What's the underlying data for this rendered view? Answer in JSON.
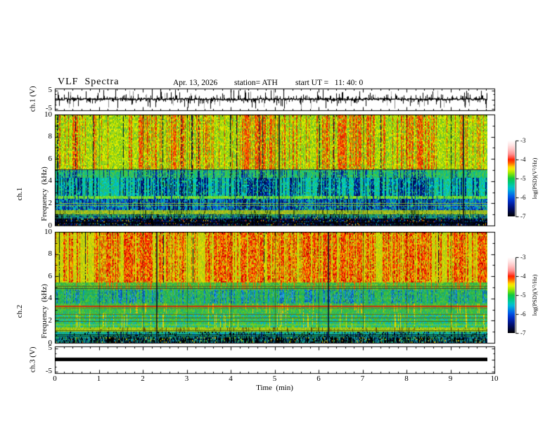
{
  "header": {
    "title": "VLF  Spectra",
    "date": "Apr. 13, 2026",
    "station": "station= ATH",
    "start_ut": "start UT =   11: 40: 0"
  },
  "axes": {
    "x_label": "Time  (min)",
    "x_ticks": [
      "0",
      "1",
      "2",
      "3",
      "4",
      "5",
      "6",
      "7",
      "8",
      "9",
      "10"
    ]
  },
  "panels": {
    "ch1_wave": {
      "ylabel": "ch.1 (V)",
      "y_ticks": [
        "5",
        "-5"
      ]
    },
    "ch1_spec": {
      "ylabel_line1": "ch.1",
      "ylabel_line2": "Frequency  (kHz)",
      "y_ticks": [
        "10",
        "8",
        "6",
        "4",
        "2",
        "0"
      ]
    },
    "ch2_spec": {
      "ylabel_line1": "ch.2",
      "ylabel_line2": "Frequency  (kHz)",
      "y_ticks": [
        "10",
        "8",
        "6",
        "4",
        "2",
        "0"
      ]
    },
    "ch3_wave": {
      "ylabel": "ch.3 (V)",
      "y_ticks": [
        "5",
        "-5"
      ]
    }
  },
  "colorbar": {
    "label": "log(PSD)(V²/Hz)",
    "ticks": [
      "-3",
      "-4",
      "-5",
      "-6",
      "-7"
    ],
    "gradient": [
      [
        "0",
        "#ffffff"
      ],
      [
        "6",
        "#ffe4e4"
      ],
      [
        "12",
        "#ffc0c0"
      ],
      [
        "18",
        "#ff9090"
      ],
      [
        "23",
        "#ff4838"
      ],
      [
        "25",
        "#ff2000"
      ],
      [
        "29",
        "#ff5800"
      ],
      [
        "32",
        "#ff9800"
      ],
      [
        "35",
        "#ffd800"
      ],
      [
        "38",
        "#e8f000"
      ],
      [
        "42",
        "#a8e800"
      ],
      [
        "47",
        "#48d820"
      ],
      [
        "50",
        "#10c840"
      ],
      [
        "55",
        "#00c878"
      ],
      [
        "60",
        "#00c8b0"
      ],
      [
        "64",
        "#00b8d8"
      ],
      [
        "68",
        "#0090e0"
      ],
      [
        "73",
        "#0060e8"
      ],
      [
        "78",
        "#0038d0"
      ],
      [
        "83",
        "#0020a8"
      ],
      [
        "88",
        "#001078"
      ],
      [
        "93",
        "#000848"
      ],
      [
        "100",
        "#000000"
      ]
    ]
  },
  "chart_data": {
    "type": "heatmap",
    "title": "VLF Spectra",
    "x": {
      "label": "Time (min)",
      "min": 0,
      "max": 10,
      "major_tick": 1,
      "minor_tick": 0.2,
      "data_end": 9.84
    },
    "colorbar": {
      "label": "log(PSD)(V²/Hz)",
      "units": "log10 V^2/Hz",
      "min": -7,
      "max": -3,
      "ticks": [
        -3,
        -4,
        -5,
        -6,
        -7
      ]
    },
    "panels": [
      {
        "id": "ch1_wave",
        "type": "line",
        "ylabel": "ch.1 (V)",
        "ylim": [
          -5,
          5
        ],
        "signal": "broadband noise near 0 V with dense impulsive spikes toward +/-5 V",
        "noise_amp": 1.5,
        "spike_p": 0.12,
        "spike_amp": [
          4,
          13
        ],
        "mid_p": 0.3,
        "mid_amp": [
          2,
          5
        ],
        "gray_spike_p": 0.07,
        "gray_amp": [
          6,
          14
        ]
      },
      {
        "id": "ch1_spec",
        "type": "heatmap",
        "ylabel": "ch.1 Frequency (kHz)",
        "ylim": [
          0,
          10
        ],
        "dark_col_p": 0.022,
        "vline_minutes": [
          5.08,
          9.28
        ],
        "bands": [
          {
            "f_hi": 10.0,
            "f_lo": 5.1,
            "base": [
              "#b8e000",
              "#9ad000",
              "#d8e800",
              "#7cc818",
              "#58c040",
              "#e8f000"
            ],
            "stripe": [
              "#e83000",
              "#ff5800",
              "#d82000",
              "#ff9000"
            ],
            "stripe_p": 0.38,
            "dark_p": 1
          },
          {
            "f_hi": 5.1,
            "f_lo": 4.35,
            "base": [
              "#30c060",
              "#18b888",
              "#50c848",
              "#00b8a0",
              "#40cc30"
            ],
            "stripe": [
              "#0830a0",
              "#001870",
              "#1040c0"
            ],
            "stripe_p": 0.33,
            "dark_p": 1
          },
          {
            "f_hi": 4.35,
            "f_lo": 2.7,
            "base": [
              "#00c8a8",
              "#20c878",
              "#00b0c8",
              "#30c050",
              "#00d0d0"
            ],
            "stripe": [
              "#001878",
              "#0030b0",
              "#000c50"
            ],
            "stripe_p": 0.45,
            "dark_p": 1
          },
          {
            "f_hi": 2.7,
            "f_lo": 2.42,
            "base": [
              "#58d838",
              "#80e030",
              "#38c850",
              "#a0e020"
            ],
            "stripe": [
              "#0040a0"
            ],
            "stripe_p": 0.15
          },
          {
            "f_hi": 2.42,
            "f_lo": 1.35,
            "base": [
              "#0838c8",
              "#0858d8",
              "#0098d8",
              "#001890",
              "#00c0b0",
              "#28b860",
              "#0870e0"
            ],
            "stripe": [
              "#000a50"
            ],
            "stripe_p": 0.3,
            "spark": [
              "#30c060"
            ],
            "spark_p": 0.06
          },
          {
            "f_hi": 1.35,
            "f_lo": 0.95,
            "base": [
              "#a8b81a",
              "#c0cc14",
              "#8fae24",
              "#5cb53a",
              "#98c020"
            ],
            "stripe": [
              "#3a5a10"
            ],
            "stripe_p": 0.12
          },
          {
            "f_hi": 0.95,
            "f_lo": 0.58,
            "base": [
              "#19a06a",
              "#0b8fa0",
              "#0f4f90",
              "#0a1e55",
              "#22ad55"
            ],
            "stripe": [
              "#000000"
            ],
            "stripe_p": 0.18,
            "spark": [
              "#d8d800"
            ],
            "spark_p": 0.03
          },
          {
            "f_hi": 0.58,
            "f_lo": 0.0,
            "base": [
              "#000000",
              "#03103c",
              "#001270",
              "#02081e"
            ],
            "stripe": [
              "#000000"
            ],
            "stripe_p": 0.2,
            "spark": [
              "#00a878",
              "#e8c800",
              "#ff5000",
              "#00a8c8",
              "#2244cc"
            ],
            "spark_p": 0.12
          }
        ],
        "hlines": [
          {
            "f": 5.05,
            "color": "#2a2a2a",
            "alpha": 0.8,
            "w": 1
          },
          {
            "f": 2.02,
            "color": "#9cc822",
            "alpha": 0.85,
            "w": 1
          },
          {
            "f": 1.85,
            "color": "#a8cc1e",
            "alpha": 0.7,
            "w": 1
          },
          {
            "f": 0.97,
            "color": "#2fa84e",
            "alpha": 0.6,
            "w": 1
          },
          {
            "f": 0.3,
            "color": "#000000",
            "alpha": 0.75,
            "w": 2
          }
        ]
      },
      {
        "id": "ch2_spec",
        "type": "heatmap",
        "ylabel": "ch.2 Frequency (kHz)",
        "ylim": [
          0,
          10
        ],
        "dark_col_p": 0.02,
        "vline_minutes": [
          2.3,
          6.2
        ],
        "bands": [
          {
            "f_hi": 10.0,
            "f_lo": 5.4,
            "base": [
              "#d8d800",
              "#c8cc08",
              "#e8e000",
              "#a0c81a",
              "#b8d40e"
            ],
            "stripe": [
              "#ff2000",
              "#e82800",
              "#ff7000",
              "#c80000",
              "#ff9800"
            ],
            "stripe_p": 0.5,
            "dark_p": 1
          },
          {
            "f_hi": 5.4,
            "f_lo": 4.85,
            "base": [
              "#55c22c",
              "#3db83e",
              "#7cc828",
              "#2ab05a"
            ],
            "stripe": [
              "#ff6000"
            ],
            "stripe_p": 0.12
          },
          {
            "f_hi": 4.85,
            "f_lo": 3.5,
            "base": [
              "#30b845",
              "#22a858",
              "#55c430",
              "#12b088"
            ],
            "stripe": [
              "#0a7fd0",
              "#2a9ae0",
              "#0a4fb8"
            ],
            "stripe_p": 0.3
          },
          {
            "f_hi": 3.5,
            "f_lo": 2.65,
            "base": [
              "#3cc037",
              "#2db856",
              "#66c825",
              "#1fb07a"
            ],
            "stripe": [
              "#e8c000"
            ],
            "stripe_p": 0.07
          },
          {
            "f_hi": 2.65,
            "f_lo": 1.35,
            "base": [
              "#2cbc4e",
              "#0abfa2",
              "#44c232",
              "#09aecb",
              "#63cc22"
            ],
            "stripe": [
              "#e8d800"
            ],
            "stripe_p": 0.06
          },
          {
            "f_hi": 1.35,
            "f_lo": 0.95,
            "base": [
              "#a4c612",
              "#c2d40c",
              "#7cb81e",
              "#94c818"
            ],
            "stripe": [
              "#6a4a08"
            ],
            "stripe_p": 0.1
          },
          {
            "f_hi": 0.95,
            "f_lo": 0.5,
            "base": [
              "#0ab8a8",
              "#28b85c",
              "#0a9cc8",
              "#18a878"
            ],
            "stripe": [
              "#062a70"
            ],
            "stripe_p": 0.12,
            "spark": [
              "#000000"
            ],
            "spark_p": 0.1
          },
          {
            "f_hi": 0.5,
            "f_lo": 0.0,
            "base": [
              "#063a66",
              "#0a9a92",
              "#021240",
              "#000000",
              "#0a84a8",
              "#1fa05a"
            ],
            "stripe": [
              "#000000"
            ],
            "stripe_p": 0.3,
            "spark": [
              "#72c808",
              "#e8a800"
            ],
            "spark_p": 0.08
          }
        ],
        "hlines": [
          {
            "f": 5.15,
            "color": "#6a4410",
            "alpha": 0.8,
            "w": 1
          },
          {
            "f": 4.92,
            "color": "#2a2a2a",
            "alpha": 0.8,
            "w": 1
          },
          {
            "f": 3.38,
            "color": "#e02000",
            "alpha": 0.9,
            "w": 2
          },
          {
            "f": 3.18,
            "color": "#b04000",
            "alpha": 0.6,
            "w": 1
          },
          {
            "f": 2.58,
            "color": "#7a5208",
            "alpha": 0.8,
            "w": 1
          },
          {
            "f": 2.3,
            "color": "#6a4408",
            "alpha": 0.8,
            "w": 1
          },
          {
            "f": 1.98,
            "color": "#5a3a08",
            "alpha": 0.7,
            "w": 1
          },
          {
            "f": 1.62,
            "color": "#c8d400",
            "alpha": 0.6,
            "w": 1
          },
          {
            "f": 1.12,
            "color": "#4a5204",
            "alpha": 0.8,
            "w": 1
          },
          {
            "f": 0.78,
            "color": "#000000",
            "alpha": 0.8,
            "w": 1
          },
          {
            "f": 0.64,
            "color": "#000000",
            "alpha": 0.7,
            "w": 1
          }
        ]
      },
      {
        "id": "ch3_wave",
        "type": "line",
        "ylabel": "ch.3 (V)",
        "ylim": [
          -5,
          5
        ],
        "signal": "flat thick trace at 0 V for full 0-9.84 min interval",
        "bar_thickness": 5
      }
    ]
  }
}
